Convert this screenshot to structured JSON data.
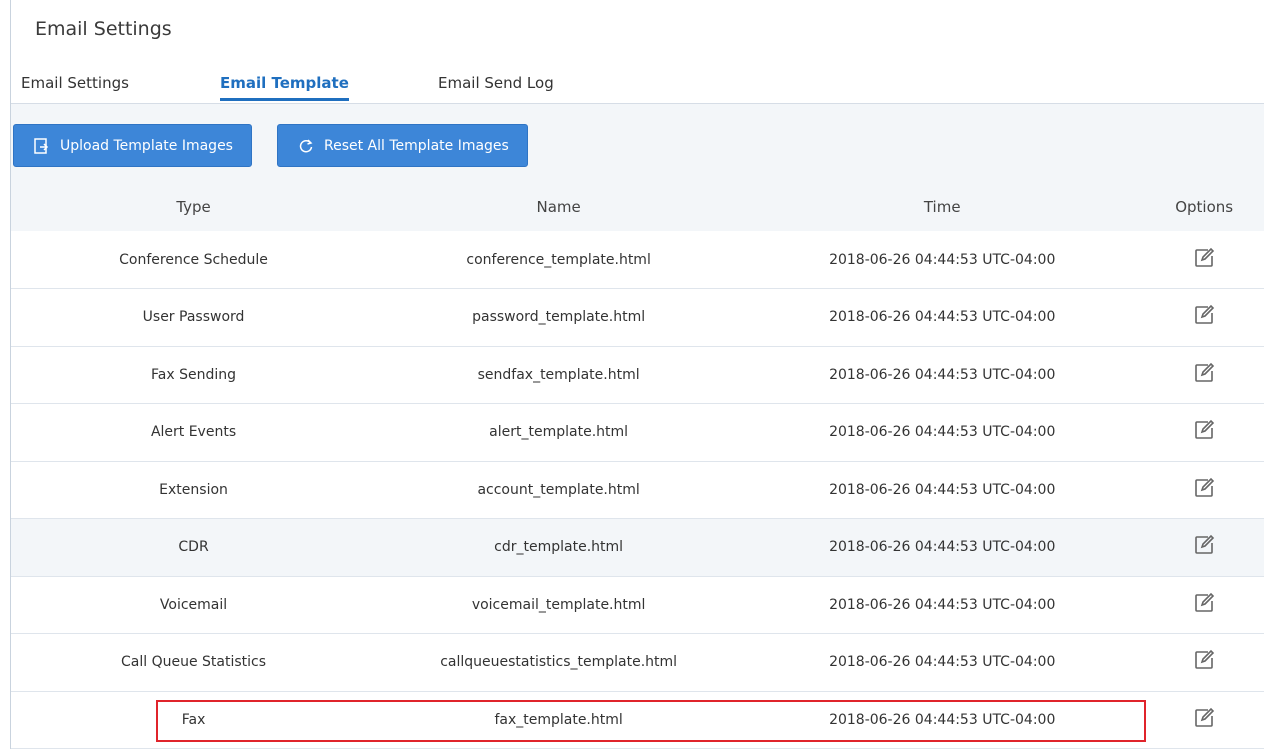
{
  "page": {
    "title": "Email Settings"
  },
  "tabs": [
    {
      "label": "Email Settings",
      "active": false
    },
    {
      "label": "Email Template",
      "active": true
    },
    {
      "label": "Email Send Log",
      "active": false
    }
  ],
  "toolbar": {
    "upload_label": "Upload Template Images",
    "reset_label": "Reset All Template Images"
  },
  "table": {
    "headers": {
      "type": "Type",
      "name": "Name",
      "time": "Time",
      "options": "Options"
    },
    "rows": [
      {
        "type": "Conference Schedule",
        "name": "conference_template.html",
        "time": "2018-06-26 04:44:53 UTC-04:00"
      },
      {
        "type": "User Password",
        "name": "password_template.html",
        "time": "2018-06-26 04:44:53 UTC-04:00"
      },
      {
        "type": "Fax Sending",
        "name": "sendfax_template.html",
        "time": "2018-06-26 04:44:53 UTC-04:00"
      },
      {
        "type": "Alert Events",
        "name": "alert_template.html",
        "time": "2018-06-26 04:44:53 UTC-04:00"
      },
      {
        "type": "Extension",
        "name": "account_template.html",
        "time": "2018-06-26 04:44:53 UTC-04:00"
      },
      {
        "type": "CDR",
        "name": "cdr_template.html",
        "time": "2018-06-26 04:44:53 UTC-04:00"
      },
      {
        "type": "Voicemail",
        "name": "voicemail_template.html",
        "time": "2018-06-26 04:44:53 UTC-04:00"
      },
      {
        "type": "Call Queue Statistics",
        "name": "callqueuestatistics_template.html",
        "time": "2018-06-26 04:44:53 UTC-04:00"
      },
      {
        "type": "Fax",
        "name": "fax_template.html",
        "time": "2018-06-26 04:44:53 UTC-04:00"
      }
    ]
  },
  "icons": {
    "upload": "upload-icon",
    "reset": "refresh-icon",
    "edit": "edit-icon"
  },
  "colors": {
    "accent": "#1f6fbf",
    "button": "#3d86d8",
    "highlight_box": "#e0242b"
  }
}
